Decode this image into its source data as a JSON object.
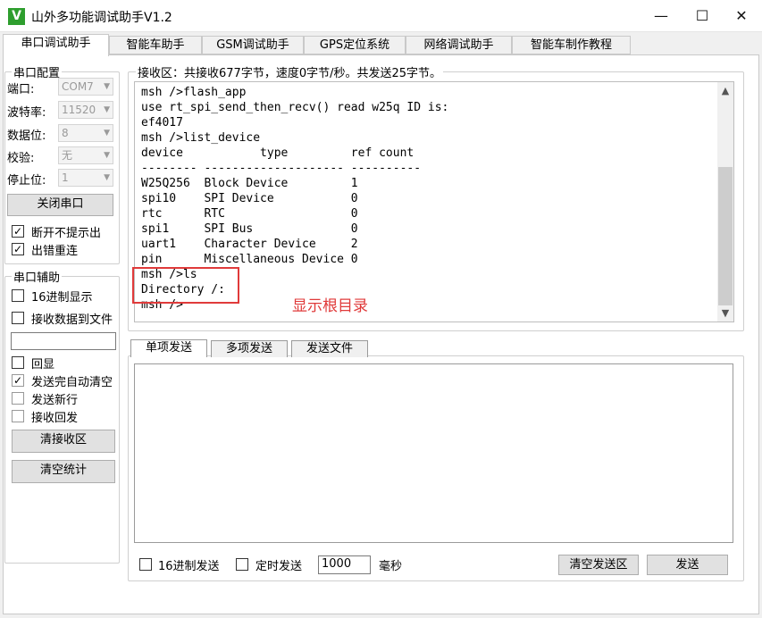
{
  "window": {
    "title": "山外多功能调试助手V1.2",
    "icon_letter": "V",
    "minimize": "—",
    "maximize": "☐",
    "close": "✕"
  },
  "tabs": [
    "串口调试助手",
    "智能车助手",
    "GSM调试助手",
    "GPS定位系统",
    "网络调试助手",
    "智能车制作教程"
  ],
  "serial_config": {
    "title": "串口配置",
    "port_label": "端口:",
    "port_value": "COM7",
    "baud_label": "波特率:",
    "baud_value": "11520",
    "data_label": "数据位:",
    "data_value": "8",
    "parity_label": "校验:",
    "parity_value": "无",
    "stop_label": "停止位:",
    "stop_value": "1",
    "close_button": "关闭串口",
    "no_prompt_label": "断开不提示出",
    "no_prompt_checked": "✓",
    "reconnect_label": "出错重连",
    "reconnect_checked": "✓"
  },
  "serial_aux": {
    "title": "串口辅助",
    "hex_display": "16进制显示",
    "save_to_file": "接收数据到文件",
    "echo": "回显",
    "auto_clear": "发送完自动清空",
    "auto_clear_mark": "✓",
    "send_newline": "发送新行",
    "recv_echo": "接收回发",
    "clear_recv_button": "清接收区",
    "clear_stats_button": "清空统计"
  },
  "receive": {
    "header": "接收区：共接收677字节，速度0字节/秒。共发送25字节。",
    "lines": [
      "msh />flash_app",
      "use rt_spi_send_then_recv() read w25q ID is:",
      "ef4017",
      "msh />list_device",
      "device           type         ref count",
      "-------- -------------------- ----------",
      "W25Q256  Block Device         1",
      "spi10    SPI Device           0",
      "rtc      RTC                  0",
      "spi1     SPI Bus              0",
      "uart1    Character Device     2",
      "pin      Miscellaneous Device 0",
      "msh />ls",
      "Directory /:",
      "msh />"
    ],
    "annotation": "显示根目录",
    "annotation_color": "#e03a3a"
  },
  "send": {
    "tabs": [
      "单项发送",
      "多项发送",
      "发送文件"
    ],
    "hex_send": "16进制发送",
    "timed_send": "定时发送",
    "interval_value": "1000",
    "interval_unit": "毫秒",
    "clear_send_button": "清空发送区",
    "send_button": "发送"
  }
}
